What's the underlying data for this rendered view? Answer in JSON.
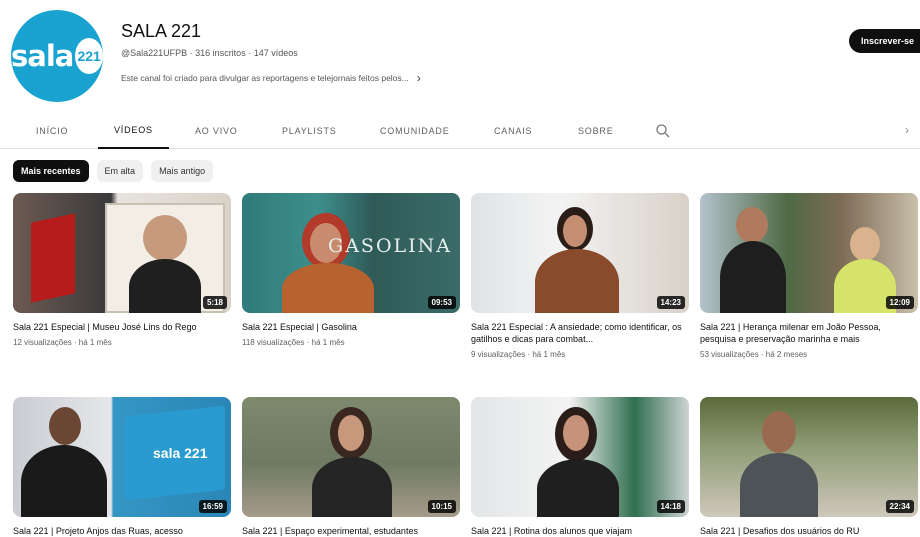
{
  "channel": {
    "logo_text": "sala",
    "logo_badge": "221",
    "name": "SALA 221",
    "meta": "@Sala221UFPB · 316 inscritos · 147 vídeos",
    "description": "Este canal foi criado para divulgar as reportagens e telejornais feitos pelos...",
    "subscribe_label": "Inscrever-se"
  },
  "tabs": [
    "INÍCIO",
    "VÍDEOS",
    "AO VIVO",
    "PLAYLISTS",
    "COMUNIDADE",
    "CANAIS",
    "SOBRE"
  ],
  "active_tab": "VÍDEOS",
  "chips": [
    "Mais recentes",
    "Em alta",
    "Mais antigo"
  ],
  "videos": [
    {
      "title": "Sala 221 Especial | Museu José Lins do Rego",
      "meta": "12 visualizações · há 1 mês",
      "duration": "5:18"
    },
    {
      "title": "Sala 221 Especial | Gasolina",
      "meta": "118 visualizações · há 1 mês",
      "duration": "09:53",
      "overlay_text": "GASOLINA"
    },
    {
      "title": "Sala 221 Especial : A ansiedade; como identificar, os gatilhos e dicas para combat...",
      "meta": "9 visualizações · há 1 mês",
      "duration": "14:23"
    },
    {
      "title": "Sala 221 | Herança milenar em João Pessoa, pesquisa e preservação marinha e mais",
      "meta": "53 visualizações · há 2 meses",
      "duration": "12:09"
    },
    {
      "title": "Sala 221 | Projeto Anjos das Ruas, acesso",
      "meta": "",
      "duration": "16:59",
      "overlay_text": "sala 221"
    },
    {
      "title": "Sala 221 | Espaço experimental, estudantes",
      "meta": "",
      "duration": "10:15"
    },
    {
      "title": "Sala 221 | Rotina dos alunos que viajam",
      "meta": "",
      "duration": "14:18"
    },
    {
      "title": "Sala 221 | Desafios dos usuários do RU",
      "meta": "",
      "duration": "22:34"
    }
  ],
  "icons": {
    "search": "search-icon",
    "tabs_next": "chevron-right-icon",
    "desc_more": "chevron-right-icon"
  },
  "colors": {
    "brand": "#1aa3d0",
    "subscribe_bg": "#0f0f0f",
    "chip_active_bg": "#0f0f0f"
  }
}
